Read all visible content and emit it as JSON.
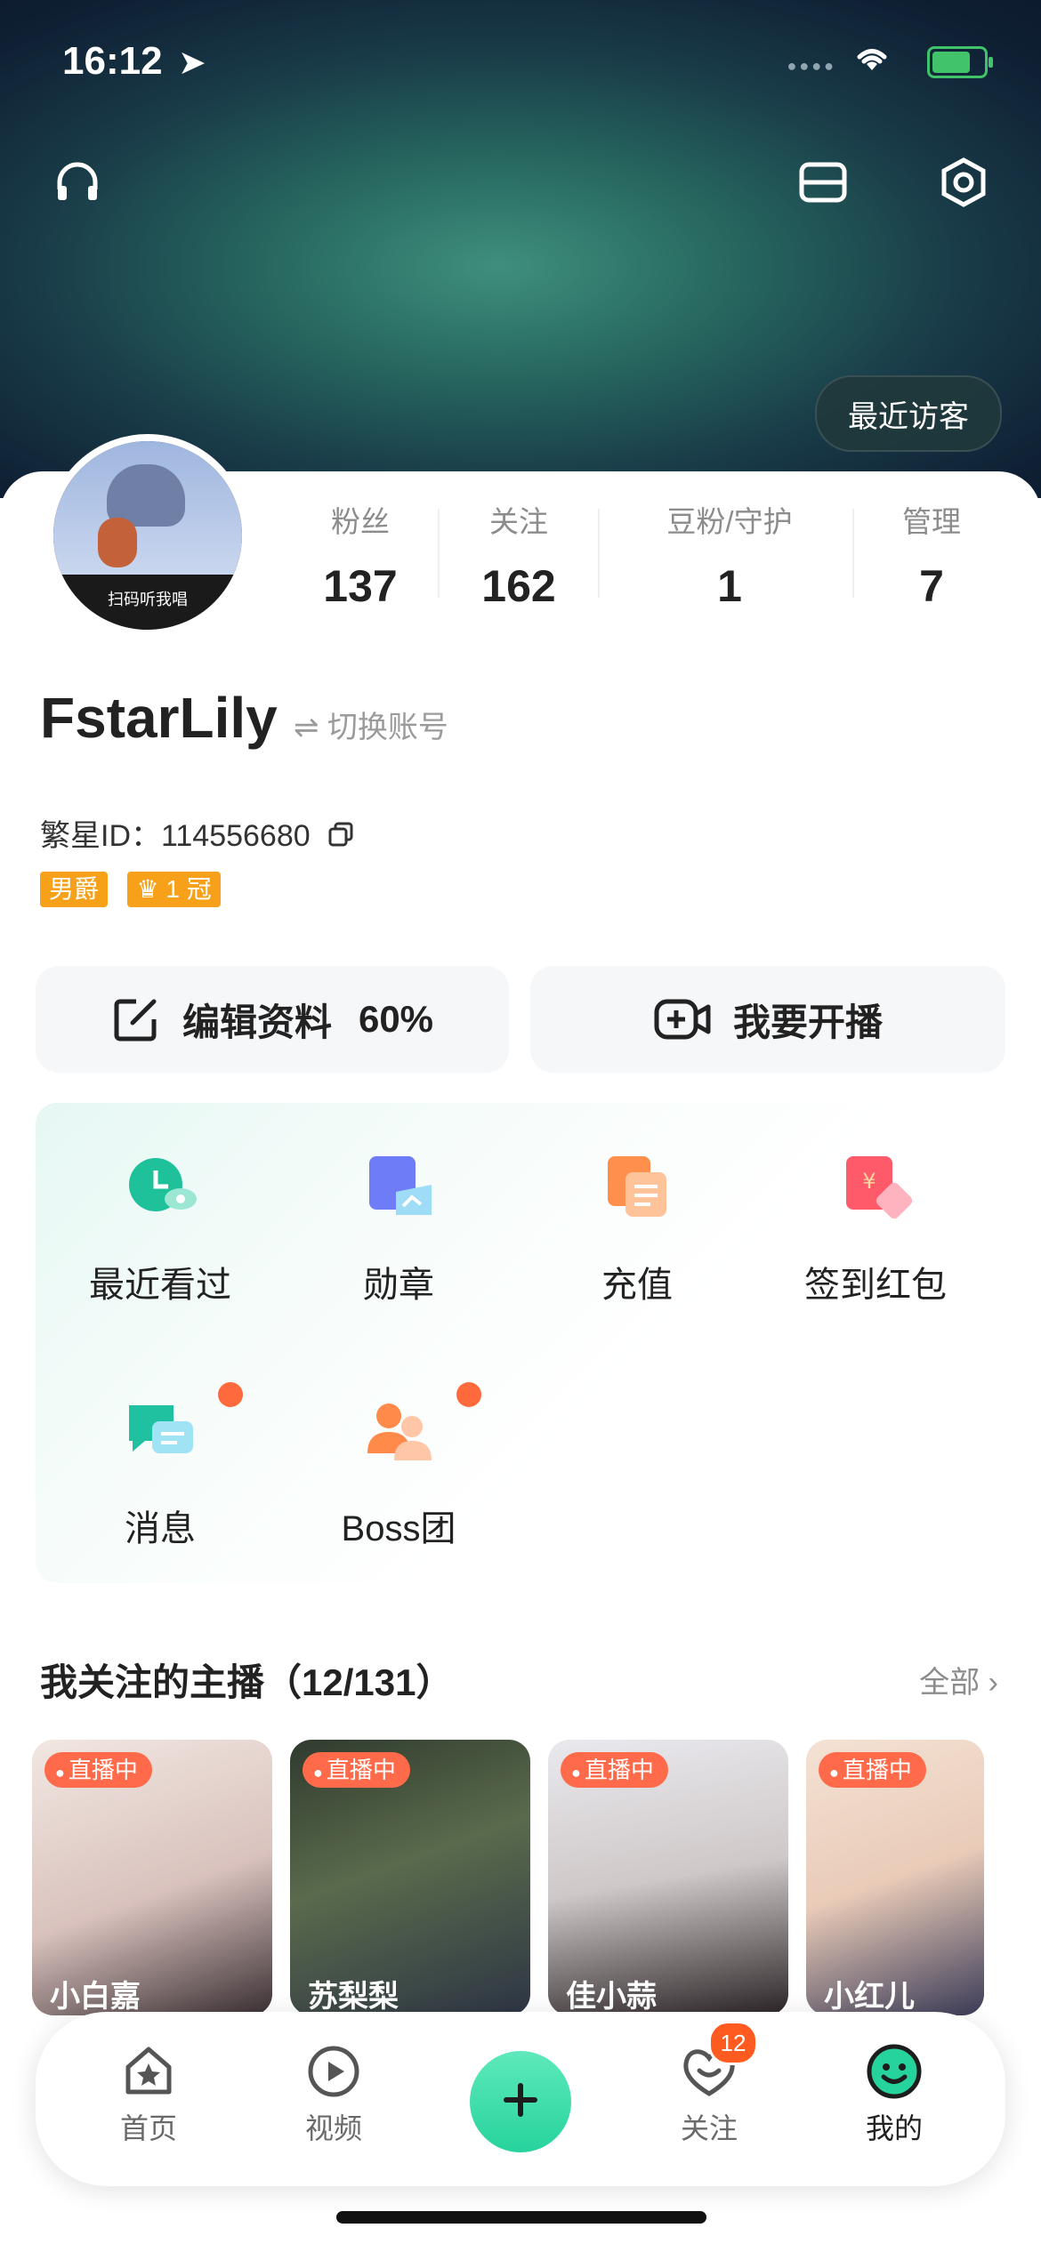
{
  "status_bar": {
    "time": "16:12",
    "location_icon": "location-arrow-icon",
    "wifi_icon": "wifi-icon",
    "battery_icon": "battery-charging-icon"
  },
  "header": {
    "headphone_icon": "headphone-icon",
    "scan_icon": "scan-icon",
    "settings_icon": "settings-icon",
    "recent_visitors_label": "最近访客"
  },
  "profile": {
    "avatar_caption": "扫码听我唱",
    "stats": [
      {
        "label": "粉丝",
        "value": "137"
      },
      {
        "label": "关注",
        "value": "162"
      },
      {
        "label": "豆粉/守护",
        "value": "1"
      },
      {
        "label": "管理",
        "value": "7"
      }
    ],
    "username": "FstarLily",
    "switch_account": "⇌ 切换账号",
    "id_label": "繁星ID：114556680",
    "badges": [
      "男爵",
      "1 冠"
    ]
  },
  "actions": {
    "edit_label": "编辑资料",
    "edit_percent": "60%",
    "broadcast_label": "我要开播"
  },
  "grid": [
    {
      "label": "最近看过",
      "icon": "clock-icon"
    },
    {
      "label": "勋章",
      "icon": "medal-icon"
    },
    {
      "label": "充值",
      "icon": "recharge-icon"
    },
    {
      "label": "签到红包",
      "icon": "red-envelope-icon"
    },
    {
      "label": "消息",
      "icon": "message-icon"
    },
    {
      "label": "Boss团",
      "icon": "boss-group-icon"
    }
  ],
  "following": {
    "title": "我关注的主播（12/131）",
    "all_label": "全部 ›",
    "streamers": [
      {
        "live_label": "直播中",
        "name": "小白嘉"
      },
      {
        "live_label": "直播中",
        "name": "苏梨梨"
      },
      {
        "live_label": "直播中",
        "name": "佳小蒜"
      },
      {
        "live_label": "直播中",
        "name": "小红儿"
      }
    ]
  },
  "bottom_nav": {
    "items": [
      {
        "label": "首页",
        "icon": "home-icon"
      },
      {
        "label": "视频",
        "icon": "video-icon"
      },
      {
        "label": "关注",
        "icon": "follow-icon",
        "badge": "12"
      },
      {
        "label": "我的",
        "icon": "me-icon"
      }
    ],
    "fab_icon": "plus-icon"
  },
  "colors": {
    "accent": "#27d39c",
    "live": "#ff6a4a",
    "badge_orange": "#f7a11a"
  }
}
